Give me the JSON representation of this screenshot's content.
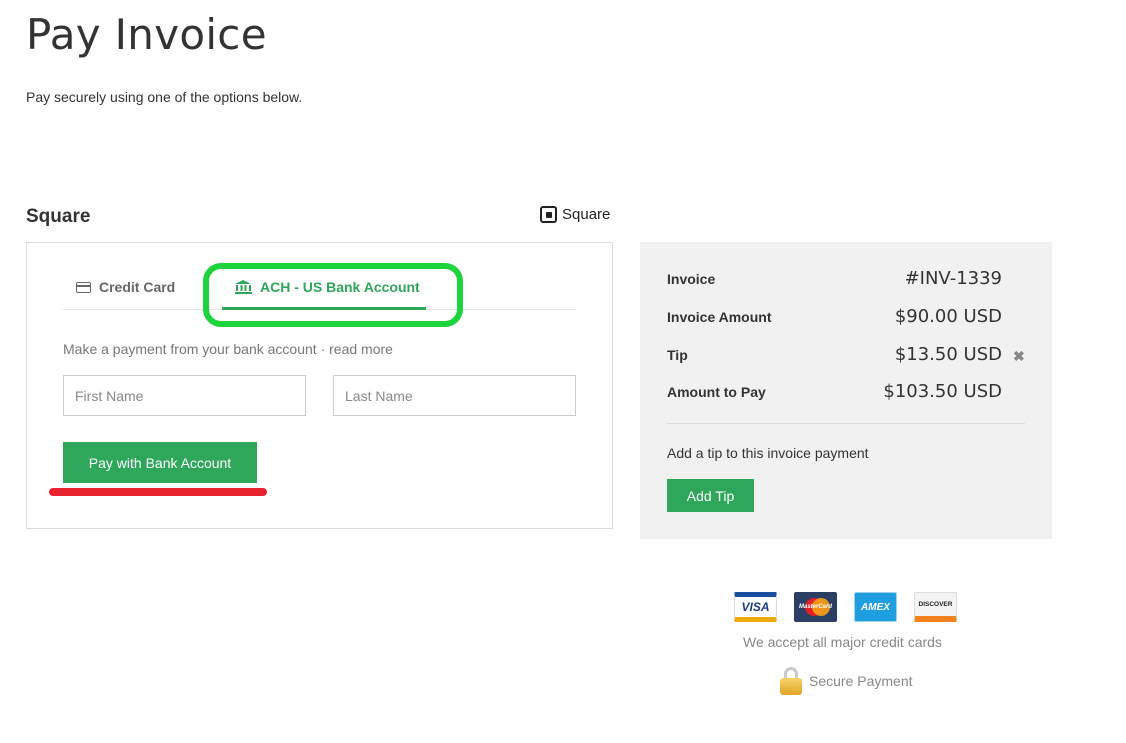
{
  "page": {
    "title": "Pay Invoice",
    "subtitle": "Pay securely using one of the options below."
  },
  "provider": {
    "heading": "Square",
    "logo_text": "Square",
    "logo_icon": "square-logo-icon"
  },
  "payment": {
    "tabs": [
      {
        "label": "Credit Card",
        "icon": "credit-card-icon",
        "active": false
      },
      {
        "label": "ACH - US Bank Account",
        "icon": "bank-icon",
        "active": true
      }
    ],
    "description": "Make a payment from your bank account · read more",
    "first_name_placeholder": "First Name",
    "last_name_placeholder": "Last Name",
    "submit_label": "Pay with Bank Account"
  },
  "summary": {
    "invoice_label": "Invoice",
    "invoice_value": "#INV-1339",
    "amount_label": "Invoice Amount",
    "amount_value": "$90.00 USD",
    "tip_label": "Tip",
    "tip_value": "$13.50 USD",
    "tip_remove": "✖",
    "total_label": "Amount to Pay",
    "total_value": "$103.50 USD",
    "tip_prompt": "Add a tip to this invoice payment",
    "add_tip_label": "Add Tip"
  },
  "footer": {
    "cards": [
      {
        "name": "VISA",
        "icon": "visa-icon"
      },
      {
        "name": "MasterCard",
        "icon": "mastercard-icon"
      },
      {
        "name": "AMEX",
        "icon": "amex-icon"
      },
      {
        "name": "DISCOVER",
        "icon": "discover-icon"
      }
    ],
    "cards_text": "We accept all major credit cards",
    "secure_text": "Secure Payment",
    "secure_icon": "lock-icon"
  },
  "colors": {
    "accent_green": "#2ea75b",
    "annotation_highlight": "#1ed43c",
    "annotation_underline": "#e8232f",
    "summary_background": "#f1f1f1"
  }
}
